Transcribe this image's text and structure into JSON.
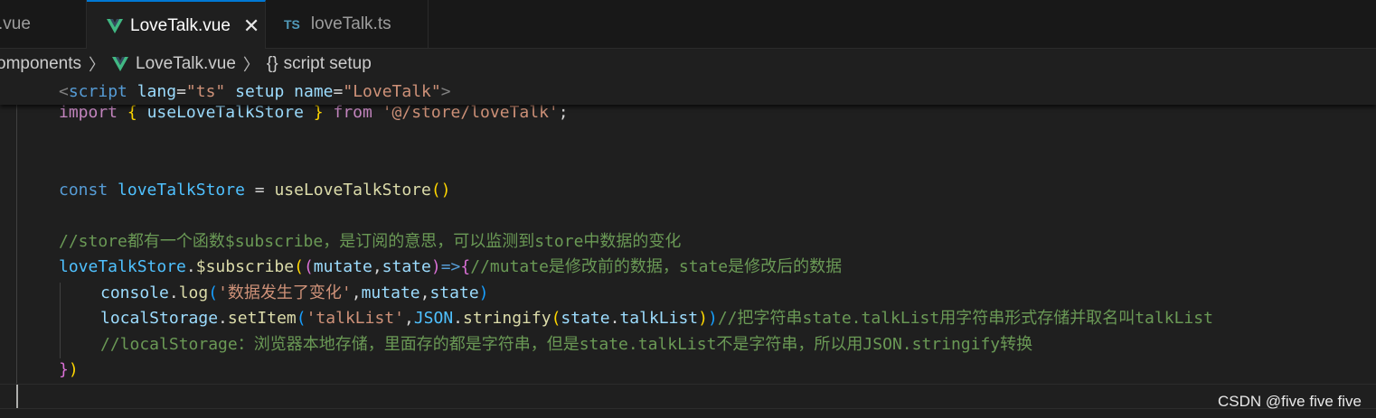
{
  "tabs": [
    {
      "label": ".vue",
      "active": false
    },
    {
      "label": "LoveTalk.vue",
      "active": true,
      "close": "✕"
    },
    {
      "label": "loveTalk.ts",
      "active": false,
      "icon_text": "TS"
    }
  ],
  "breadcrumb": {
    "folder": "omponents",
    "sep": "〉",
    "file": "LoveTalk.vue",
    "braces": "{}",
    "symbol": "script setup"
  },
  "code": {
    "l1": {
      "a": "<",
      "b": "script",
      "c": "lang",
      "d": "=",
      "e": "\"ts\"",
      "f": "setup",
      "g": "name",
      "h": "\"LoveTalk\"",
      "i": ">"
    },
    "l2": {
      "a": "import",
      "b": "{",
      "c": "useLoveTalkStore",
      "d": "}",
      "e": "from",
      "f": "'@/store/loveTalk'",
      "g": ";"
    },
    "l3": {
      "a": "const",
      "b": "loveTalkStore",
      "c": " = ",
      "d": "useLoveTalkStore",
      "e": "()"
    },
    "l4": {
      "a": "//store都有一个函数$subscribe，是订阅的意思，可以监测到store中数据的变化"
    },
    "l5": {
      "a": "loveTalkStore",
      "b": ".",
      "c": "$subscribe",
      "d": "(",
      "e": "(",
      "f": "mutate",
      "g": ",",
      "h": "state",
      "i": ")",
      "j": "=>",
      "k": "{",
      "l": "//mutate是修改前的数据，state是修改后的数据"
    },
    "l6": {
      "a": "console",
      "b": ".",
      "c": "log",
      "d": "(",
      "e": "'数据发生了变化'",
      "f": ",",
      "g": "mutate",
      "h": ",",
      "i": "state",
      "j": ")"
    },
    "l7": {
      "a": "localStorage",
      "b": ".",
      "c": "setItem",
      "d": "(",
      "e": "'talkList'",
      "f": ",",
      "g": "JSON",
      "h": ".",
      "i": "stringify",
      "j": "(",
      "k": "state",
      "l": ".",
      "m": "talkList",
      "n": ")",
      "o": ")",
      "p": "//把字符串state.talkList用字符串形式存储并取名叫talkList"
    },
    "l8": {
      "a": "//localStorage：浏览器本地存储，里面存的都是字符串，但是state.talkList不是字符串，所以用JSON.stringify转换"
    },
    "l9": {
      "a": "})"
    }
  },
  "watermark": "CSDN @five five five",
  "colors": {
    "active_tab_border": "#0078d4",
    "keyword": "#c586c0",
    "declaration": "#569cd6",
    "variable": "#9cdcfe",
    "string": "#ce9178",
    "function": "#dcdcaa",
    "comment": "#6a9955",
    "vue_green": "#41b883"
  }
}
